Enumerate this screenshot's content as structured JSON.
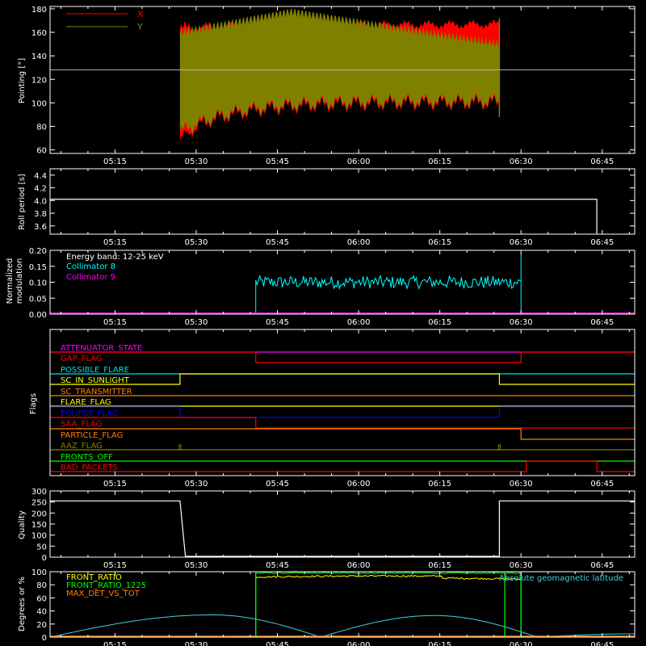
{
  "colors": {
    "background": "#000000",
    "axis": "#ffffff",
    "x": "#ff0000",
    "y": "#808000",
    "c8": "#00ffff",
    "c9": "#ff00ff",
    "white": "#ffffff",
    "yellow": "#ffff00",
    "green": "#00ff00",
    "orange": "#ff8000",
    "cyan": "#00e0e0",
    "blue": "#0000ff",
    "red": "#ff0000",
    "olive": "#808000",
    "lightcyan": "#40d0e0"
  },
  "x_axis": {
    "range": [
      "05:03",
      "06:51"
    ],
    "tick_labels": [
      "05:15",
      "05:30",
      "05:45",
      "06:00",
      "06:15",
      "06:30",
      "06:45"
    ],
    "tick_minutes": [
      315,
      330,
      345,
      360,
      375,
      390,
      405
    ]
  },
  "chart_data": [
    {
      "type": "area",
      "ylabel": "Pointing [°]",
      "ylim": [
        57,
        182
      ],
      "ytick_labels": [
        "60",
        "80",
        "100",
        "120",
        "140",
        "160",
        "180"
      ],
      "legend": [
        "X",
        "Y"
      ],
      "legend_position": "top-left",
      "reference_line": 128,
      "start": "05:27",
      "end": "06:26",
      "series": [
        {
          "name": "X",
          "upper_start": 163,
          "upper_end": 165,
          "lower_start": 67,
          "lower_end": 118
        },
        {
          "name": "Y",
          "upper_start": 160,
          "upper_peak": 178,
          "upper_end": 150,
          "lower_start": 75,
          "lower_end": 102
        }
      ]
    },
    {
      "type": "line",
      "ylabel": "Roll period [s]",
      "ylim": [
        3.47,
        4.5
      ],
      "ytick_labels": [
        "3.6",
        "3.8",
        "4.0",
        "4.2",
        "4.4"
      ],
      "value": 4.02,
      "end": "06:44",
      "drop_to": 3.47
    },
    {
      "type": "line",
      "ylabel": "Normalized modulation",
      "ylim": [
        0,
        0.2
      ],
      "ytick_labels": [
        "0.00",
        "0.05",
        "0.10",
        "0.15",
        "0.20"
      ],
      "annotation": "Energy band: 12-25 keV",
      "series": [
        {
          "name": "Collimator 8",
          "start": "05:41",
          "end": "06:30",
          "mean": 0.1,
          "spread": 0.02,
          "spike_end": 0.19
        },
        {
          "name": "Collimator 9",
          "value": 0.0
        }
      ]
    },
    {
      "type": "line",
      "ylabel": "Flags",
      "flags": [
        {
          "name": "ATTENUATOR_STATE",
          "color": "#ff00ff",
          "segments": [
            [
              "05:03",
              "06:51",
              0
            ]
          ]
        },
        {
          "name": "GAP_FLAG",
          "color": "#ff0000",
          "segments": [
            [
              "05:03",
              "05:41",
              1
            ],
            [
              "05:41",
              "06:30",
              0
            ],
            [
              "06:30",
              "06:51",
              1
            ]
          ]
        },
        {
          "name": "POSSIBLE_FLARE",
          "color": "#00e0e0",
          "segments": [
            [
              "05:03",
              "06:51",
              0
            ]
          ]
        },
        {
          "name": "SC_IN_SUNLIGHT",
          "color": "#ffff00",
          "segments": [
            [
              "05:03",
              "05:27",
              0
            ],
            [
              "05:27",
              "06:26",
              1
            ],
            [
              "06:26",
              "06:51",
              0
            ]
          ]
        },
        {
          "name": "SC_TRANSMITTER",
          "color": "#ff8000",
          "segments": [
            [
              "05:03",
              "06:51",
              0
            ]
          ]
        },
        {
          "name": "FLARE_FLAG",
          "color": "#ffff00",
          "segments": [
            [
              "05:03",
              "06:51",
              0
            ]
          ]
        },
        {
          "name": "ECLIPSE_FLAG",
          "color": "#0000ff",
          "segments": [
            [
              "05:03",
              "05:27",
              1
            ],
            [
              "05:27",
              "06:26",
              0
            ],
            [
              "06:26",
              "06:51",
              1
            ]
          ]
        },
        {
          "name": "SAA_FLAG",
          "color": "#ff0000",
          "segments": [
            [
              "05:03",
              "05:41",
              1
            ],
            [
              "05:41",
              "06:51",
              0
            ]
          ]
        },
        {
          "name": "PARTICLE_FLAG",
          "color": "#ff8000",
          "segments": [
            [
              "05:03",
              "06:30",
              1
            ],
            [
              "06:30",
              "06:51",
              0
            ]
          ]
        },
        {
          "name": "AAZ_FLAG",
          "color": "#808000",
          "segments": [
            [
              "05:03",
              "06:51",
              0
            ]
          ],
          "spikes": [
            "05:27",
            "06:26"
          ]
        },
        {
          "name": "FRONTS_OFF",
          "color": "#00ff00",
          "segments": [
            [
              "05:03",
              "06:51",
              0
            ]
          ]
        },
        {
          "name": "BAD_PACKETS",
          "color": "#ff0000",
          "segments": [
            [
              "05:03",
              "06:31",
              0
            ],
            [
              "06:31",
              "06:44",
              1
            ],
            [
              "06:44",
              "06:51",
              0
            ]
          ]
        }
      ]
    },
    {
      "type": "line",
      "ylabel": "Quality",
      "ylim": [
        0,
        300
      ],
      "ytick_labels": [
        "0",
        "50",
        "100",
        "150",
        "200",
        "250",
        "300"
      ],
      "segments": [
        [
          "05:03",
          "05:27",
          255
        ],
        [
          "05:28",
          "06:26",
          0
        ],
        [
          "06:26",
          "06:51",
          255
        ]
      ]
    },
    {
      "type": "line",
      "ylabel": "Degrees or %",
      "ylim": [
        0,
        100
      ],
      "ytick_labels": [
        "0",
        "20",
        "40",
        "60",
        "80",
        "100"
      ],
      "annotation": "Absolute geomagnetic latitude",
      "series": [
        {
          "name": "FRONT_RATIO",
          "start": "05:41",
          "end": "06:30",
          "value": 92
        },
        {
          "name": "FRONT_RATIO_1225",
          "start": "05:41",
          "end": "06:30",
          "value": 98
        },
        {
          "name": "MAX_DET_VS_TOT",
          "value": 0
        },
        {
          "name": "Absolute geomagnetic latitude",
          "peaks": [
            [
              "05:33",
              34
            ],
            [
              "06:14",
              33
            ]
          ],
          "troughs": [
            [
              "05:53",
              0
            ],
            [
              "06:33",
              0
            ]
          ],
          "start_value": 0,
          "end_value": 5
        }
      ],
      "vertical_lines": [
        "05:41",
        "06:27",
        "06:30"
      ]
    }
  ]
}
